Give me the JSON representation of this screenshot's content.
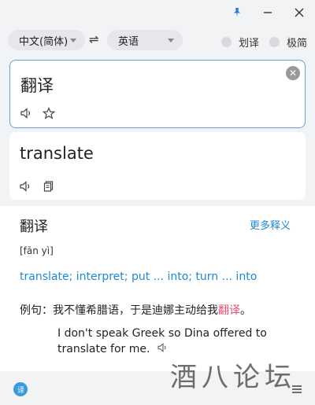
{
  "titlebar": {
    "pin_icon": "pin-icon",
    "minimize_icon": "minimize-icon",
    "close_icon": "close-icon"
  },
  "languages": {
    "source": "中文(简体)",
    "target": "英语",
    "swap_glyph": "⇌"
  },
  "toggles": [
    {
      "label": "划译",
      "on": false
    },
    {
      "label": "极简",
      "on": false
    }
  ],
  "input": {
    "text": "翻译"
  },
  "result": {
    "text": "translate"
  },
  "dictionary": {
    "word": "翻译",
    "more_link": "更多释义",
    "phonetic": "[fān yì]",
    "definitions": "translate; interpret; put ... into; turn ... into",
    "example_label": "例句：",
    "example_before": "我不懂希腊语，于是迪娜主动给我",
    "example_highlight": "翻译",
    "example_after": "。",
    "example_en": "I don't speak Greek so Dina offered to translate for me."
  },
  "footer": {
    "watermark": "酒八论坛"
  },
  "colors": {
    "accent": "#1e88d8",
    "highlight": "#e5506d",
    "focus_border": "#5aa3e8"
  }
}
